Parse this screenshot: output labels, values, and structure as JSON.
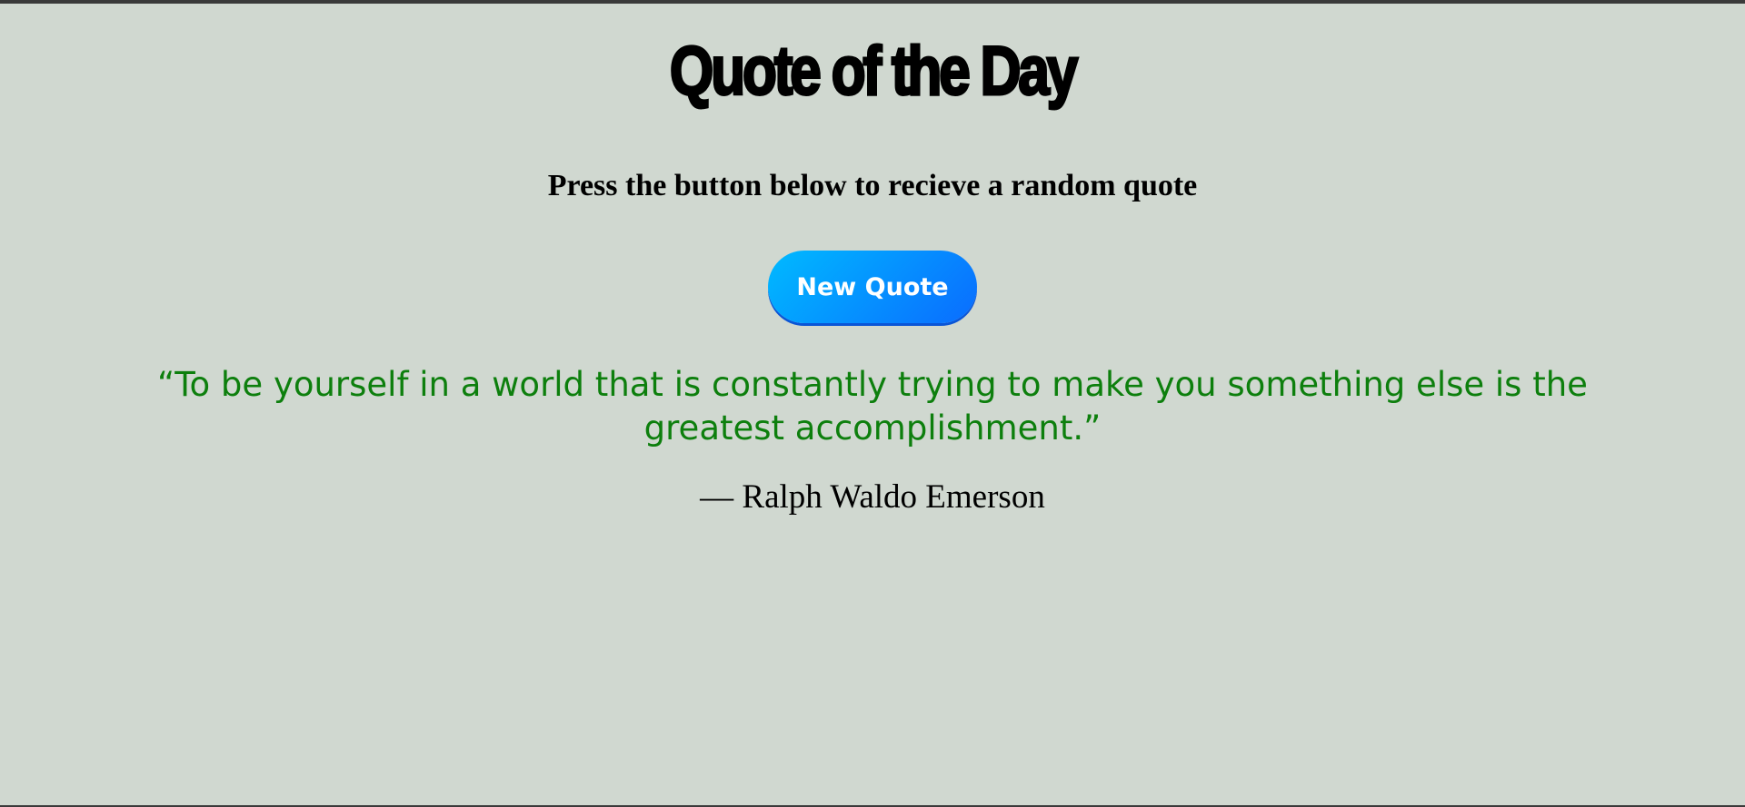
{
  "header": {
    "title": "Quote of the Day",
    "instruction": "Press the button below to recieve a random quote"
  },
  "actions": {
    "new_quote_label": "New Quote"
  },
  "quote": {
    "text": "“To be yourself in a world that is constantly trying to make you something else is the greatest accomplishment.”",
    "author": "— Ralph Waldo Emerson"
  },
  "colors": {
    "background": "#d0d8d0",
    "quote_text": "#0d7f0d",
    "button_gradient_start": "#00baff",
    "button_gradient_end": "#0a6cff",
    "button_text": "#ffffff"
  }
}
